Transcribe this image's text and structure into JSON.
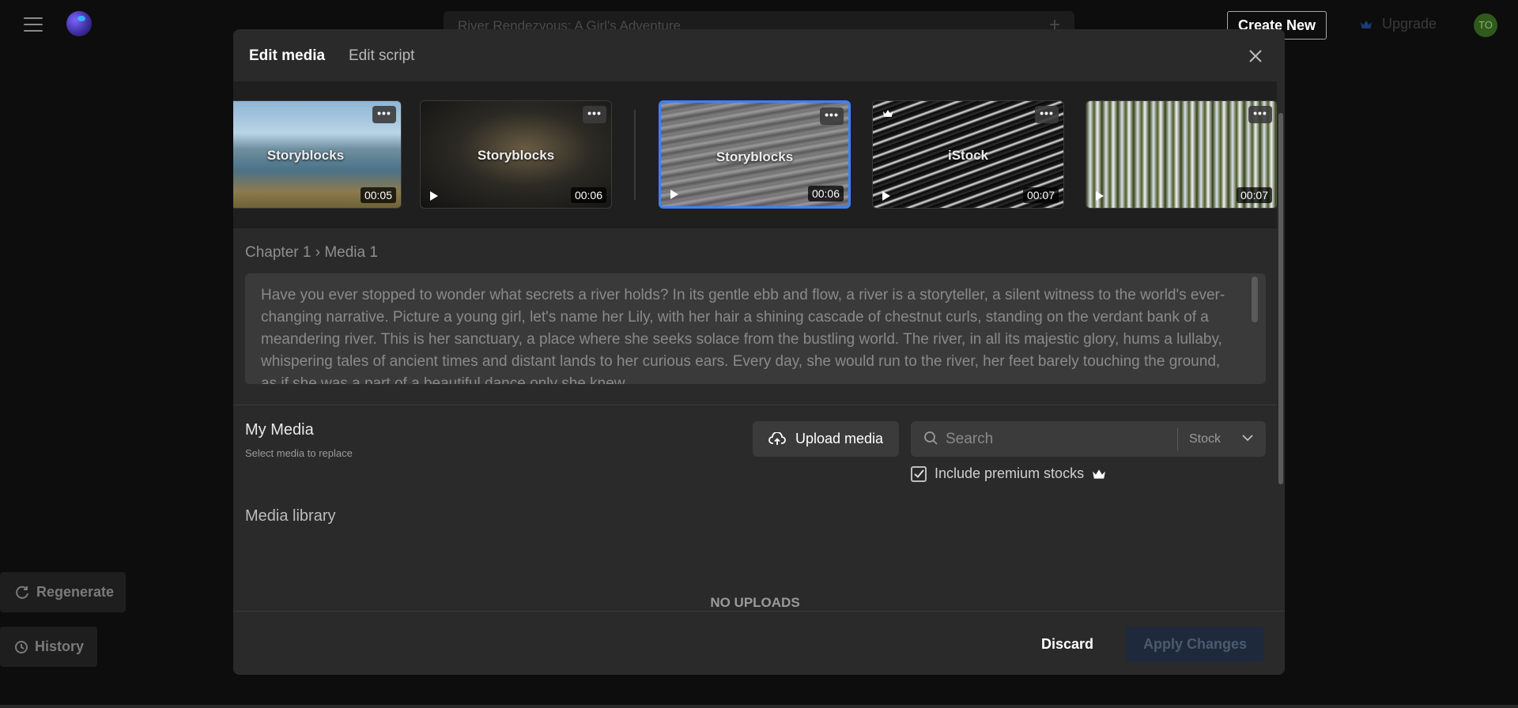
{
  "app": {
    "project_title": "River Rendezvous: A Girl's Adventure",
    "create_new_label": "Create New",
    "upgrade_label": "Upgrade",
    "avatar_initials": "TO",
    "regenerate_label": "Regenerate",
    "history_label": "History"
  },
  "modal": {
    "tabs": [
      {
        "label": "Edit media",
        "active": true
      },
      {
        "label": "Edit script",
        "active": false
      }
    ],
    "thumbnails": [
      {
        "source": "Storyblocks",
        "duration": "00:05",
        "selected": false,
        "premium": false
      },
      {
        "source": "Storyblocks",
        "duration": "00:06",
        "selected": false,
        "premium": false
      },
      {
        "source": "Storyblocks",
        "duration": "00:06",
        "selected": true,
        "premium": false
      },
      {
        "source": "iStock",
        "duration": "00:07",
        "selected": false,
        "premium": true
      },
      {
        "source": "",
        "duration": "00:07",
        "selected": false,
        "premium": false
      }
    ],
    "breadcrumb": "Chapter 1 › Media 1",
    "script_text": "Have you ever stopped to wonder what secrets a river holds? In its gentle ebb and flow, a river is a storyteller, a silent witness to the world's ever-changing narrative. Picture a young girl, let's name her Lily, with her hair a shining cascade of chestnut curls, standing on the verdant bank of a meandering river. This is her sanctuary, a place where she seeks solace from the bustling world. The river, in all its majestic glory, hums a lullaby, whispering tales of ancient times and distant lands to her curious ears. Every day, she would run to the river, her feet barely touching the ground, as if she was a part of a beautiful dance only she knew.",
    "my_media": {
      "title": "My Media",
      "subtitle": "Select media to replace",
      "upload_label": "Upload media",
      "search_placeholder": "Search",
      "source_filter": "Stock",
      "premium_label": "Include premium stocks",
      "premium_checked": true
    },
    "library_title": "Media library",
    "empty_state": "NO UPLOADS",
    "discard_label": "Discard",
    "apply_label": "Apply Changes"
  },
  "colors": {
    "accent": "#3b82f6",
    "modal_bg": "#2a2a2a",
    "page_bg": "#0d0d0d"
  },
  "icons": [
    "menu-icon",
    "logo-icon",
    "plus-icon",
    "crown-icon",
    "close-icon",
    "more-icon",
    "play-icon",
    "upload-cloud-icon",
    "search-icon",
    "chevron-down-icon",
    "check-icon",
    "refresh-icon",
    "clock-icon"
  ]
}
